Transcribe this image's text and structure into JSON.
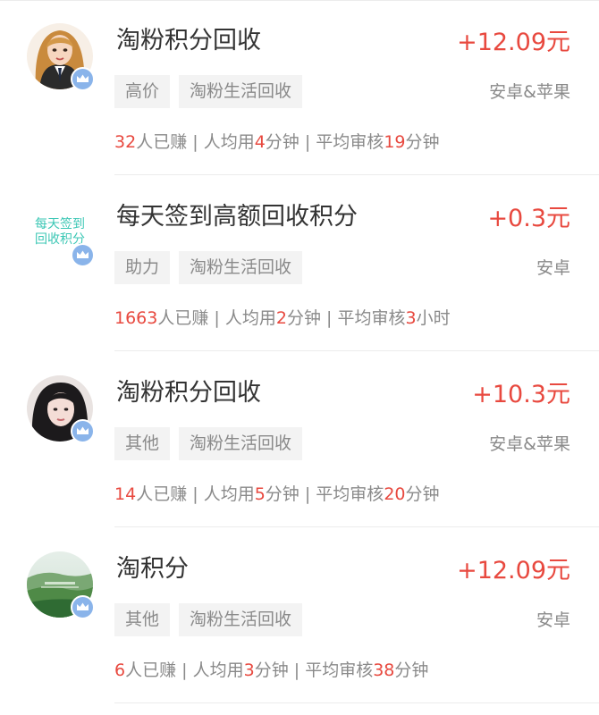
{
  "colors": {
    "accent": "#e8493f",
    "muted": "#8a8a8a",
    "title": "#333333",
    "tag_bg": "#f3f3f3",
    "badge": "#8ab4ea",
    "teal_text": "#3cc7b5"
  },
  "labels": {
    "earned_suffix": "人已赚",
    "sep": " | ",
    "avg_prefix": "人均用",
    "review_prefix": "平均审核"
  },
  "tasks": [
    {
      "avatar": "cartoon-girl-avatar",
      "title": "淘粉积分回收",
      "reward": "+12.09元",
      "tags": [
        "高价",
        "淘粉生活回收"
      ],
      "platform": "安卓&苹果",
      "earned": "32",
      "avg_time": "4",
      "avg_unit": "分钟",
      "review_time": "19",
      "review_unit": "分钟"
    },
    {
      "avatar": "text-avatar",
      "avatar_lines": [
        "每天签到",
        "回收积分"
      ],
      "title": "每天签到高额回收积分",
      "reward": "+0.3元",
      "tags": [
        "助力",
        "淘粉生活回收"
      ],
      "platform": "安卓",
      "earned": "1663",
      "avg_time": "2",
      "avg_unit": "分钟",
      "review_time": "3",
      "review_unit": "小时"
    },
    {
      "avatar": "girl-photo-avatar",
      "title": "淘粉积分回收",
      "reward": "+10.3元",
      "tags": [
        "其他",
        "淘粉生活回收"
      ],
      "platform": "安卓&苹果",
      "earned": "14",
      "avg_time": "5",
      "avg_unit": "分钟",
      "review_time": "20",
      "review_unit": "分钟"
    },
    {
      "avatar": "landscape-avatar",
      "title": "淘积分",
      "reward": "+12.09元",
      "tags": [
        "其他",
        "淘粉生活回收"
      ],
      "platform": "安卓",
      "earned": "6",
      "avg_time": "3",
      "avg_unit": "分钟",
      "review_time": "38",
      "review_unit": "分钟"
    }
  ]
}
